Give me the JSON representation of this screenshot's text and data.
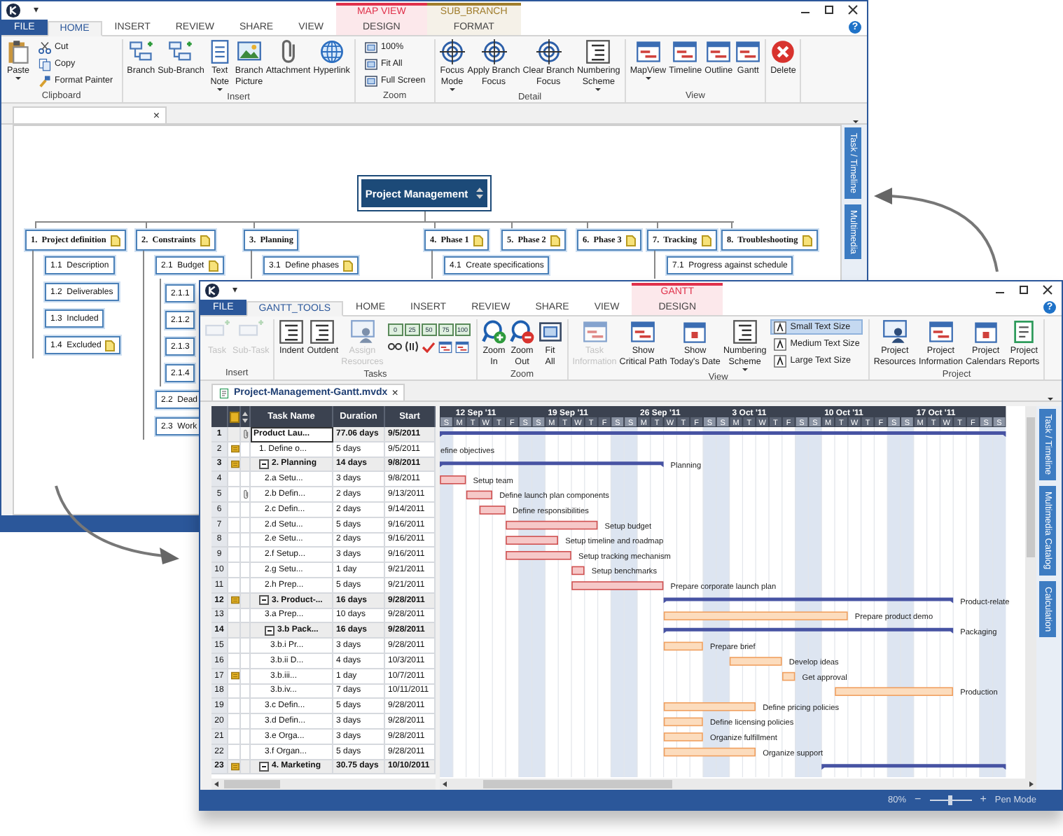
{
  "back_window": {
    "quick_access": "▾",
    "tabs": [
      {
        "label": "FILE",
        "kind": "file",
        "selected": false
      },
      {
        "label": "HOME",
        "kind": "tab",
        "selected": true
      },
      {
        "label": "INSERT",
        "kind": "tab",
        "selected": false
      },
      {
        "label": "REVIEW",
        "kind": "tab",
        "selected": false
      },
      {
        "label": "SHARE",
        "kind": "tab",
        "selected": false
      },
      {
        "label": "VIEW",
        "kind": "tab",
        "selected": false
      }
    ],
    "context_tabs": [
      {
        "label": "MAP VIEW",
        "color": "#e0314b",
        "tabs": [
          {
            "label": "DESIGN",
            "selected": false
          }
        ]
      },
      {
        "label": "SUB_BRANCH",
        "color": "#a07d2c",
        "tabs": [
          {
            "label": "FORMAT",
            "selected": false
          }
        ]
      }
    ],
    "help": "?",
    "ribbon": [
      {
        "label": "Clipboard",
        "buttons": [
          {
            "label": "Paste",
            "kind": "large",
            "dropdown": true,
            "disabled": false
          },
          {
            "label": "Cut",
            "kind": "small",
            "disabled": false
          },
          {
            "label": "Copy",
            "kind": "small",
            "disabled": false
          },
          {
            "label": "Format Painter",
            "kind": "small",
            "disabled": false
          }
        ]
      },
      {
        "label": "Insert",
        "buttons": [
          {
            "label": "Branch",
            "kind": "large",
            "disabled": false
          },
          {
            "label": "Sub-Branch",
            "kind": "large",
            "disabled": false
          },
          {
            "label": "Text\nNote",
            "kind": "large",
            "dropdown": true,
            "disabled": false
          },
          {
            "label": "Branch\nPicture",
            "kind": "large",
            "disabled": false
          },
          {
            "label": "Attachment",
            "kind": "large",
            "disabled": false
          },
          {
            "label": "Hyperlink",
            "kind": "large",
            "disabled": false
          }
        ]
      },
      {
        "label": "Zoom",
        "buttons": [
          {
            "label": "100%",
            "kind": "small",
            "disabled": false
          },
          {
            "label": "Fit All",
            "kind": "small",
            "disabled": false
          },
          {
            "label": "Full Screen",
            "kind": "small",
            "disabled": false
          }
        ]
      },
      {
        "label": "Detail",
        "buttons": [
          {
            "label": "Focus\nMode",
            "kind": "large",
            "dropdown": true,
            "disabled": false
          },
          {
            "label": "Apply Branch\nFocus",
            "kind": "large",
            "disabled": false
          },
          {
            "label": "Clear Branch\nFocus",
            "kind": "large",
            "disabled": false
          },
          {
            "label": "Numbering\nScheme",
            "kind": "large",
            "dropdown": true,
            "disabled": false
          }
        ]
      },
      {
        "label": "View",
        "buttons": [
          {
            "label": "MapView",
            "kind": "large",
            "dropdown": true,
            "disabled": false
          },
          {
            "label": "Timeline",
            "kind": "large",
            "disabled": false
          },
          {
            "label": "Outline",
            "kind": "large",
            "disabled": false
          },
          {
            "label": "Gantt",
            "kind": "large",
            "disabled": false
          }
        ]
      },
      {
        "buttons": [
          {
            "label": "Delete",
            "kind": "large",
            "disabled": false
          }
        ]
      }
    ],
    "document_tab": {
      "close": "×"
    },
    "mind_map": {
      "root": "Project Management",
      "branches": [
        {
          "label": "1.  Project definition",
          "note": true,
          "children": [
            {
              "label": "1.1  Description",
              "note": false
            },
            {
              "label": "1.2  Deliverables",
              "note": false
            },
            {
              "label": "1.3  Included",
              "note": false
            },
            {
              "label": "1.4  Excluded",
              "note": true
            }
          ]
        },
        {
          "label": "2.  Constraints",
          "note": true,
          "children": [
            {
              "label": "2.1  Budget",
              "note": true,
              "children": [
                {
                  "label": "2.1.1"
                },
                {
                  "label": "2.1.2"
                },
                {
                  "label": "2.1.3"
                },
                {
                  "label": "2.1.4"
                }
              ]
            },
            {
              "label": "2.2  Dead"
            },
            {
              "label": "2.3  Work"
            }
          ]
        },
        {
          "label": "3.  Planning",
          "note": false,
          "children": [
            {
              "label": "3.1  Define phases",
              "note": true
            }
          ]
        },
        {
          "label": "4.  Phase 1",
          "note": true,
          "children": [
            {
              "label": "4.1  Create specifications",
              "note": false
            }
          ]
        },
        {
          "label": "5.  Phase 2",
          "note": true
        },
        {
          "label": "6.  Phase 3",
          "note": true
        },
        {
          "label": "7.  Tracking",
          "note": true,
          "children": [
            {
              "label": "7.1  Progress against schedule",
              "note": false
            }
          ]
        },
        {
          "label": "8.  Troubleshooting",
          "note": true
        }
      ]
    },
    "side_tabs": [
      "Task / Timeline",
      "Multimedia"
    ]
  },
  "front_window": {
    "quick_access": "▾",
    "tabs": [
      {
        "label": "FILE",
        "kind": "file",
        "selected": false
      },
      {
        "label": "GANTT_TOOLS",
        "kind": "tab",
        "selected": true
      },
      {
        "label": "HOME",
        "kind": "tab",
        "selected": false
      },
      {
        "label": "INSERT",
        "kind": "tab",
        "selected": false
      },
      {
        "label": "REVIEW",
        "kind": "tab",
        "selected": false
      },
      {
        "label": "SHARE",
        "kind": "tab",
        "selected": false
      },
      {
        "label": "VIEW",
        "kind": "tab",
        "selected": false
      }
    ],
    "context_tabs": [
      {
        "label": "GANTT",
        "color": "#e0314b",
        "tabs": [
          {
            "label": "DESIGN",
            "selected": false
          }
        ]
      }
    ],
    "help": "?",
    "ribbon": [
      {
        "label": "Insert",
        "buttons": [
          {
            "label": "Task",
            "kind": "large",
            "disabled": true
          },
          {
            "label": "Sub-Task",
            "kind": "large",
            "disabled": true
          }
        ]
      },
      {
        "label": "Tasks",
        "buttons": [
          {
            "label": "Indent",
            "kind": "large",
            "disabled": false
          },
          {
            "label": "Outdent",
            "kind": "large",
            "disabled": false
          },
          {
            "label": "Assign\nResources",
            "kind": "large",
            "disabled": true
          },
          {
            "label": "0",
            "kind": "progress",
            "disabled": false
          },
          {
            "label": "25",
            "kind": "progress",
            "disabled": false
          },
          {
            "label": "50",
            "kind": "progress",
            "disabled": false
          },
          {
            "label": "75",
            "kind": "progress",
            "disabled": false
          },
          {
            "label": "100",
            "kind": "progress",
            "disabled": false
          }
        ]
      },
      {
        "label": "Zoom",
        "buttons": [
          {
            "label": "Zoom\nIn",
            "kind": "large",
            "disabled": false
          },
          {
            "label": "Zoom\nOut",
            "kind": "large",
            "disabled": false
          },
          {
            "label": "Fit\nAll",
            "kind": "large",
            "disabled": false
          }
        ]
      },
      {
        "label": "View",
        "buttons": [
          {
            "label": "Task\nInformation",
            "kind": "large",
            "disabled": true
          },
          {
            "label": "Show\nCritical Path",
            "kind": "large",
            "disabled": false
          },
          {
            "label": "Show\nToday's Date",
            "kind": "large",
            "disabled": false
          },
          {
            "label": "Numbering\nScheme",
            "kind": "large",
            "dropdown": true,
            "disabled": false
          },
          {
            "label": "Small Text Size",
            "kind": "small",
            "selected": true,
            "disabled": false
          },
          {
            "label": "Medium Text Size",
            "kind": "small",
            "selected": false,
            "disabled": false
          },
          {
            "label": "Large Text Size",
            "kind": "small",
            "selected": false,
            "disabled": false
          }
        ]
      },
      {
        "label": "Project",
        "buttons": [
          {
            "label": "Project\nResources",
            "kind": "large",
            "disabled": false
          },
          {
            "label": "Project\nInformation",
            "kind": "large",
            "disabled": false
          },
          {
            "label": "Project\nCalendars",
            "kind": "large",
            "disabled": false
          },
          {
            "label": "Project\nReports",
            "kind": "large",
            "disabled": false
          }
        ]
      }
    ],
    "document_tab": {
      "title": "Project-Management-Gantt.mvdx",
      "close": "×"
    },
    "gantt": {
      "columns": [
        "Task Name",
        "Duration",
        "Start"
      ],
      "timeline": {
        "lead_days": [
          "S"
        ],
        "weeks": [
          {
            "label": "12 Sep '11",
            "days": [
              "M",
              "T",
              "W",
              "T",
              "F",
              "S",
              "S"
            ]
          },
          {
            "label": "19 Sep '11",
            "days": [
              "M",
              "T",
              "W",
              "T",
              "F",
              "S",
              "S"
            ]
          },
          {
            "label": "26 Sep '11",
            "days": [
              "M",
              "T",
              "W",
              "T",
              "F",
              "S",
              "S"
            ]
          },
          {
            "label": "3 Oct '11",
            "days": [
              "M",
              "T",
              "W",
              "T",
              "F",
              "S",
              "S"
            ]
          },
          {
            "label": "10 Oct '11",
            "days": [
              "M",
              "T",
              "W",
              "T",
              "F",
              "S",
              "S"
            ]
          },
          {
            "label": "17 Oct '11",
            "days": [
              "M",
              "T",
              "W",
              "T",
              "F",
              "S",
              "S"
            ]
          }
        ]
      },
      "rows": [
        {
          "number": "1",
          "name": "Product Lau...",
          "duration": "77.06 days",
          "start": "9/5/2011",
          "kind": "summary",
          "selected": true,
          "note": false,
          "attachment": true,
          "children": [
            {
              "number": "2",
              "name": "1. Define o...",
              "duration": "5 days",
              "start": "9/5/2011",
              "kind": "task",
              "selected": false,
              "note": true,
              "attachment": false,
              "bar_label": "efine objectives"
            },
            {
              "number": "3",
              "name": "2. Planning",
              "duration": "14 days",
              "start": "9/8/2011",
              "kind": "summary",
              "expanded": true,
              "selected": false,
              "note": true,
              "attachment": false,
              "bar_label": "Planning",
              "children": [
                {
                  "number": "4",
                  "name": "2.a Setu...",
                  "duration": "3 days",
                  "start": "9/8/2011",
                  "kind": "critical",
                  "selected": false,
                  "note": false,
                  "attachment": false,
                  "bar_label": "Setup team"
                },
                {
                  "number": "5",
                  "name": "2.b Defin...",
                  "duration": "2 days",
                  "start": "9/13/2011",
                  "kind": "critical",
                  "selected": false,
                  "note": false,
                  "attachment": true,
                  "bar_label": "Define launch plan components"
                },
                {
                  "number": "6",
                  "name": "2.c Defin...",
                  "duration": "2 days",
                  "start": "9/14/2011",
                  "kind": "critical",
                  "selected": false,
                  "note": false,
                  "attachment": false,
                  "bar_label": "Define responsibilities"
                },
                {
                  "number": "7",
                  "name": "2.d Setu...",
                  "duration": "5 days",
                  "start": "9/16/2011",
                  "kind": "critical",
                  "selected": false,
                  "note": false,
                  "attachment": false,
                  "bar_label": "Setup budget"
                },
                {
                  "number": "8",
                  "name": "2.e Setu...",
                  "duration": "2 days",
                  "start": "9/16/2011",
                  "kind": "critical",
                  "selected": false,
                  "note": false,
                  "attachment": false,
                  "bar_label": "Setup timeline and roadmap"
                },
                {
                  "number": "9",
                  "name": "2.f Setup...",
                  "duration": "3 days",
                  "start": "9/16/2011",
                  "kind": "critical",
                  "selected": false,
                  "note": false,
                  "attachment": false,
                  "bar_label": "Setup tracking mechanism"
                },
                {
                  "number": "10",
                  "name": "2.g Setu...",
                  "duration": "1 day",
                  "start": "9/21/2011",
                  "kind": "critical",
                  "selected": false,
                  "note": false,
                  "attachment": false,
                  "bar_label": "Setup benchmarks"
                },
                {
                  "number": "11",
                  "name": "2.h Prep...",
                  "duration": "5 days",
                  "start": "9/21/2011",
                  "kind": "critical",
                  "selected": false,
                  "note": false,
                  "attachment": false,
                  "bar_label": "Prepare corporate launch plan"
                }
              ]
            },
            {
              "number": "12",
              "name": "3. Product-...",
              "duration": "16 days",
              "start": "9/28/2011",
              "kind": "summary",
              "expanded": true,
              "selected": false,
              "note": true,
              "attachment": false,
              "bar_label": "Product-relate",
              "children": [
                {
                  "number": "13",
                  "name": "3.a Prep...",
                  "duration": "10 days",
                  "start": "9/28/2011",
                  "kind": "task",
                  "selected": false,
                  "note": false,
                  "attachment": false,
                  "bar_label": "Prepare product demo"
                },
                {
                  "number": "14",
                  "name": "3.b Pack...",
                  "duration": "16 days",
                  "start": "9/28/2011",
                  "kind": "summary",
                  "expanded": true,
                  "selected": false,
                  "note": false,
                  "attachment": false,
                  "bar_label": "Packaging",
                  "children": [
                    {
                      "number": "15",
                      "name": "3.b.i Pr...",
                      "duration": "3 days",
                      "start": "9/28/2011",
                      "kind": "task",
                      "selected": false,
                      "note": false,
                      "attachment": false,
                      "bar_label": "Prepare brief"
                    },
                    {
                      "number": "16",
                      "name": "3.b.ii D...",
                      "duration": "4 days",
                      "start": "10/3/2011",
                      "kind": "task",
                      "selected": false,
                      "note": false,
                      "attachment": false,
                      "bar_label": "Develop ideas"
                    },
                    {
                      "number": "17",
                      "name": "3.b.iii...",
                      "duration": "1 day",
                      "start": "10/7/2011",
                      "kind": "task",
                      "selected": false,
                      "note": true,
                      "attachment": false,
                      "bar_label": "Get approval"
                    },
                    {
                      "number": "18",
                      "name": "3.b.iv...",
                      "duration": "7 days",
                      "start": "10/11/2011",
                      "kind": "task",
                      "selected": false,
                      "note": false,
                      "attachment": false,
                      "bar_label": "Production"
                    }
                  ]
                },
                {
                  "number": "19",
                  "name": "3.c Defin...",
                  "duration": "5 days",
                  "start": "9/28/2011",
                  "kind": "task",
                  "selected": false,
                  "note": false,
                  "attachment": false,
                  "bar_label": "Define pricing policies"
                },
                {
                  "number": "20",
                  "name": "3.d Defin...",
                  "duration": "3 days",
                  "start": "9/28/2011",
                  "kind": "task",
                  "selected": false,
                  "note": false,
                  "attachment": false,
                  "bar_label": "Define licensing policies"
                },
                {
                  "number": "21",
                  "name": "3.e Orga...",
                  "duration": "3 days",
                  "start": "9/28/2011",
                  "kind": "task",
                  "selected": false,
                  "note": false,
                  "attachment": false,
                  "bar_label": "Organize fulfillment"
                },
                {
                  "number": "22",
                  "name": "3.f Organ...",
                  "duration": "5 days",
                  "start": "9/28/2011",
                  "kind": "task",
                  "selected": false,
                  "note": false,
                  "attachment": false,
                  "bar_label": "Organize support"
                }
              ]
            },
            {
              "number": "23",
              "name": "4. Marketing",
              "duration": "30.75 days",
              "start": "10/10/2011",
              "kind": "summary",
              "expanded": true,
              "selected": false,
              "note": true,
              "attachment": false
            }
          ]
        }
      ]
    },
    "side_tabs": [
      "Task / Timeline",
      "Multimedia Catalog",
      "Calculation"
    ],
    "status_bar": {
      "zoom_reading": "80%",
      "zoom_out": "−",
      "zoom_in": "+",
      "level": 0.5,
      "mode": "Pen Mode"
    }
  }
}
